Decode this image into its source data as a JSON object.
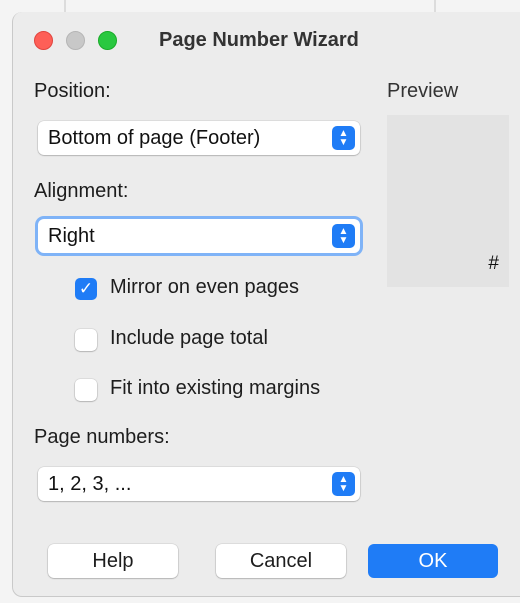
{
  "window": {
    "title": "Page Number Wizard"
  },
  "position": {
    "label": "Position:",
    "value": "Bottom of page (Footer)"
  },
  "alignment": {
    "label": "Alignment:",
    "value": "Right"
  },
  "preview": {
    "label": "Preview",
    "marker": "#"
  },
  "options": {
    "mirror": {
      "label": "Mirror on even pages",
      "checked": true
    },
    "total": {
      "label": "Include page total",
      "checked": false
    },
    "fit": {
      "label": "Fit into existing margins",
      "checked": false
    }
  },
  "page_numbers": {
    "label": "Page numbers:",
    "value": "1, 2, 3, ..."
  },
  "buttons": {
    "help": "Help",
    "cancel": "Cancel",
    "ok": "OK"
  },
  "glyphs": {
    "checkmark": "✓",
    "stepper_up": "▲",
    "stepper_down": "▼"
  },
  "colors": {
    "accent": "#1f7cf6",
    "close": "#fe5f57",
    "zoom": "#29c840"
  }
}
